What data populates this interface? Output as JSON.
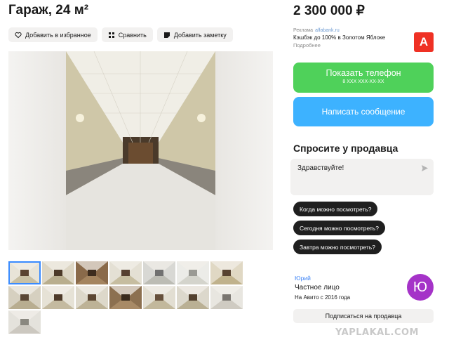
{
  "listing": {
    "title": "Гараж, 24 м²",
    "price": "2 300 000 ₽"
  },
  "actions": {
    "favorite": "Добавить в избранное",
    "compare": "Сравнить",
    "note": "Добавить заметку"
  },
  "ad": {
    "tag": "Реклама",
    "domain": "alfabank.ru",
    "text": "Кэшбэк до 100% в Золотом Яблоке",
    "more": "Подробнее",
    "logo_letter": "А",
    "logo_color": "#ef3124"
  },
  "contact": {
    "phone_label": "Показать телефон",
    "phone_mask": "8 XXX XXX-XX-XX",
    "message_label": "Написать сообщение",
    "phone_color": "#4fd15a",
    "message_color": "#3db2ff"
  },
  "ask": {
    "title": "Спросите у продавца",
    "message_value": "Здравствуйте!",
    "questions": [
      "Когда можно посмотреть?",
      "Сегодня можно посмотреть?",
      "Завтра можно посмотреть?"
    ]
  },
  "seller": {
    "name": "Юрий",
    "type": "Частное лицо",
    "since": "На Авито с 2016 года",
    "avatar_letter": "Ю",
    "avatar_color": "#a533c8",
    "subscribe_label": "Подписаться на продавца"
  },
  "gallery": {
    "thumbnail_count": 15,
    "active_index": 0
  },
  "watermark": "YAPLAKAL.COM"
}
